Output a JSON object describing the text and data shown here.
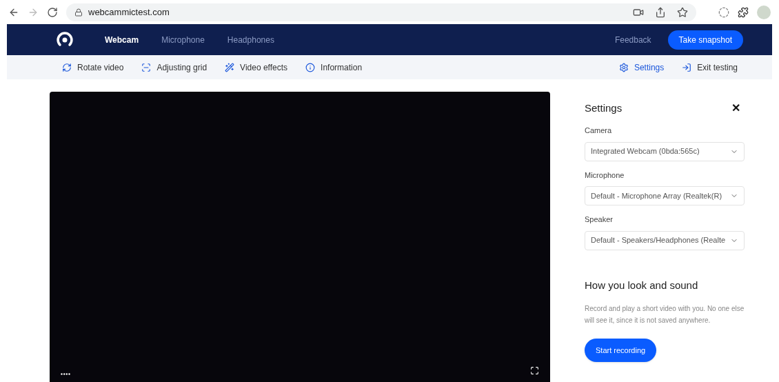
{
  "browser": {
    "url": "webcammictest.com"
  },
  "nav": {
    "tabs": [
      {
        "label": "Webcam",
        "selected": true
      },
      {
        "label": "Microphone",
        "selected": false
      },
      {
        "label": "Headphones",
        "selected": false
      }
    ],
    "feedback": "Feedback",
    "snapshot_button": "Take snapshot"
  },
  "toolbar": {
    "left": [
      {
        "label": "Rotate video",
        "kind": "rotate"
      },
      {
        "label": "Adjusting grid",
        "kind": "grid"
      },
      {
        "label": "Video effects",
        "kind": "wand"
      },
      {
        "label": "Information",
        "kind": "info"
      }
    ],
    "right": [
      {
        "label": "Settings",
        "kind": "gear",
        "selected": true
      },
      {
        "label": "Exit testing",
        "kind": "exit",
        "selected": false
      }
    ]
  },
  "settings": {
    "title": "Settings",
    "close": "✕",
    "fields": [
      {
        "label": "Camera",
        "value": "Integrated Webcam (0bda:565c)"
      },
      {
        "label": "Microphone",
        "value": "Default - Microphone Array (Realtek(R)"
      },
      {
        "label": "Speaker",
        "value": "Default - Speakers/Headphones (Realte"
      }
    ],
    "heading": "How you look and sound",
    "description": "Record and play a short video with you. No one else will see it, since it is not saved anywhere.",
    "record_button": "Start recording"
  }
}
